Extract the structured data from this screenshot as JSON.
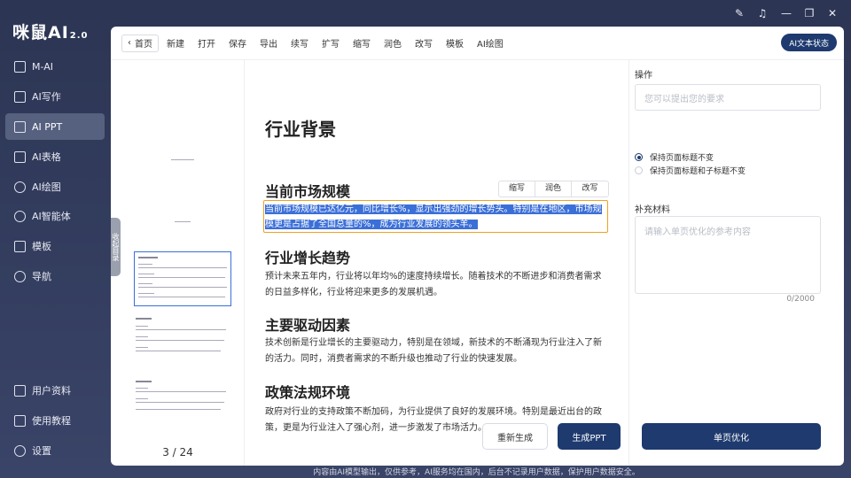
{
  "app": {
    "logo": "咪鼠AI",
    "version": "2.0"
  },
  "sidebar": {
    "items": [
      {
        "label": "M-AI",
        "icon": "cube-icon"
      },
      {
        "label": "AI写作",
        "icon": "pen-icon"
      },
      {
        "label": "AI PPT",
        "icon": "ppt-icon",
        "active": true
      },
      {
        "label": "AI表格",
        "icon": "table-icon"
      },
      {
        "label": "AI绘图",
        "icon": "paint-icon"
      },
      {
        "label": "AI智能体",
        "icon": "robot-icon"
      },
      {
        "label": "模板",
        "icon": "template-icon"
      },
      {
        "label": "导航",
        "icon": "navigation-icon"
      }
    ],
    "bottom_items": [
      {
        "label": "用户资料",
        "icon": "user-doc-icon"
      },
      {
        "label": "使用教程",
        "icon": "tutorial-icon"
      },
      {
        "label": "设置",
        "icon": "gear-icon"
      }
    ]
  },
  "window": {
    "controls": [
      "note-icon",
      "bell-icon",
      "minimize-icon",
      "restore-icon",
      "close-icon"
    ]
  },
  "toolbar": {
    "back_label": "首页",
    "items": [
      "新建",
      "打开",
      "保存",
      "导出",
      "续写",
      "扩写",
      "缩写",
      "润色",
      "改写",
      "模板",
      "AI绘图"
    ],
    "status_label": "AI文本状态"
  },
  "thumbnails": {
    "collapse_label": "收起目录",
    "current_page": "3 / 24"
  },
  "editor": {
    "title": "行业背景",
    "sections": [
      {
        "heading": "当前市场规模",
        "text": "当前市场规模已达亿元，同比增长%，显示出强劲的增长势头。特别是在地区，市场规模更是占据了全国总量的%，成为行业发展的领头羊。"
      },
      {
        "heading": "行业增长趋势",
        "text": "预计未来五年内，行业将以年均%的速度持续增长。随着技术的不断进步和消费者需求的日益多样化，行业将迎来更多的发展机遇。"
      },
      {
        "heading": "主要驱动因素",
        "text": "技术创新是行业增长的主要驱动力，特别是在领域，新技术的不断涌现为行业注入了新的活力。同时，消费者需求的不断升级也推动了行业的快速发展。"
      },
      {
        "heading": "政策法规环境",
        "text": "政府对行业的支持政策不断加码，为行业提供了良好的发展环境。特别是最近出台的政策，更是为行业注入了强心剂，进一步激发了市场活力。"
      }
    ],
    "mini_actions": [
      "缩写",
      "润色",
      "改写"
    ],
    "regenerate_label": "重新生成",
    "generate_label": "生成PPT"
  },
  "right_panel": {
    "operation_label": "操作",
    "request_placeholder": "您可以提出您的要求",
    "radio_options": [
      {
        "label": "保持页面标题不变",
        "checked": true
      },
      {
        "label": "保持页面标题和子标题不变",
        "checked": false
      }
    ],
    "supplement_label": "补充材料",
    "supplement_placeholder": "请输入单页优化的参考内容",
    "char_counter": "0/2000",
    "optimize_label": "单页优化"
  },
  "footer": {
    "note": "内容由AI模型输出，仅供参考，AI服务均在国内，后台不记录用户数据，保护用户数据安全。"
  }
}
